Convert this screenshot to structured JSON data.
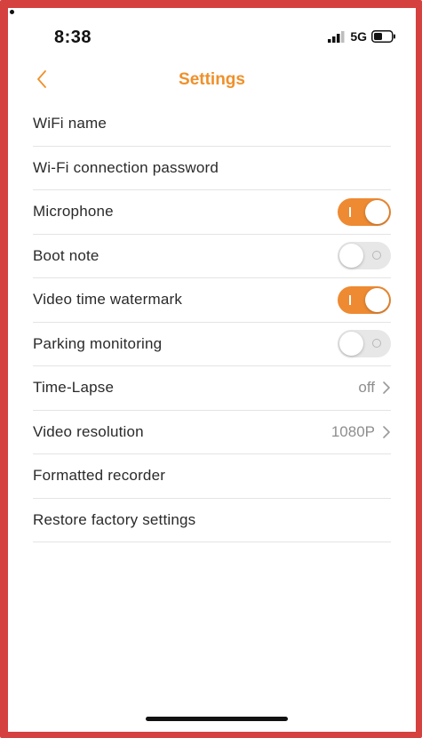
{
  "status_bar": {
    "time": "8:38",
    "network": "5G",
    "icons": [
      "signal-icon",
      "battery-icon"
    ]
  },
  "nav": {
    "title": "Settings",
    "back_icon": "chevron-left-icon"
  },
  "colors": {
    "accent": "#f0902a",
    "toggle_on": "#ee8a32",
    "toggle_off": "#e7e7e7",
    "frame_border": "#d5413f"
  },
  "settings": [
    {
      "label": "WiFi name"
    },
    {
      "label": "Wi-Fi connection password"
    },
    {
      "label": "Microphone",
      "toggle": "on"
    },
    {
      "label": "Boot note",
      "toggle": "off"
    },
    {
      "label": "Video time watermark",
      "toggle": "on"
    },
    {
      "label": "Parking monitoring",
      "toggle": "off"
    },
    {
      "label": "Time-Lapse",
      "value": "off"
    },
    {
      "label": "Video resolution",
      "value": "1080P"
    },
    {
      "label": "Formatted recorder"
    },
    {
      "label": "Restore factory settings"
    }
  ]
}
